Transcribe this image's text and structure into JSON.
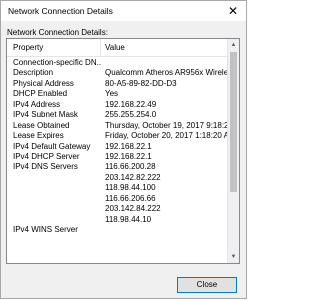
{
  "window": {
    "title": "Network Connection Details"
  },
  "section_label": "Network Connection Details:",
  "columns": {
    "property": "Property",
    "value": "Value"
  },
  "rows": [
    {
      "property": "Connection-specific DN...",
      "value": ""
    },
    {
      "property": "Description",
      "value": "Qualcomm Atheros AR956x Wireless N"
    },
    {
      "property": "Physical Address",
      "value": "80-A5-89-82-DD-D3"
    },
    {
      "property": "DHCP Enabled",
      "value": "Yes"
    },
    {
      "property": "IPv4 Address",
      "value": "192.168.22.49"
    },
    {
      "property": "IPv4 Subnet Mask",
      "value": "255.255.254.0"
    },
    {
      "property": "Lease Obtained",
      "value": "Thursday, October 19, 2017 9:18:20 AM"
    },
    {
      "property": "Lease Expires",
      "value": "Friday, October 20, 2017 1:18:20 AM"
    },
    {
      "property": "IPv4 Default Gateway",
      "value": "192.168.22.1"
    },
    {
      "property": "IPv4 DHCP Server",
      "value": "192.168.22.1"
    },
    {
      "property": "IPv4 DNS Servers",
      "value": "116.66.200.28"
    },
    {
      "property": "",
      "value": "203.142.82.222"
    },
    {
      "property": "",
      "value": "118.98.44.100"
    },
    {
      "property": "",
      "value": "116.66.206.66"
    },
    {
      "property": "",
      "value": "203.142.84.222"
    },
    {
      "property": "",
      "value": "118.98.44.10"
    },
    {
      "property": "IPv4 WINS Server",
      "value": ""
    }
  ],
  "close_button_label": "Close",
  "icons": {
    "title_close": "close-icon",
    "scroll_up": "scroll-up-arrow-icon",
    "scroll_down": "scroll-down-arrow-icon"
  }
}
